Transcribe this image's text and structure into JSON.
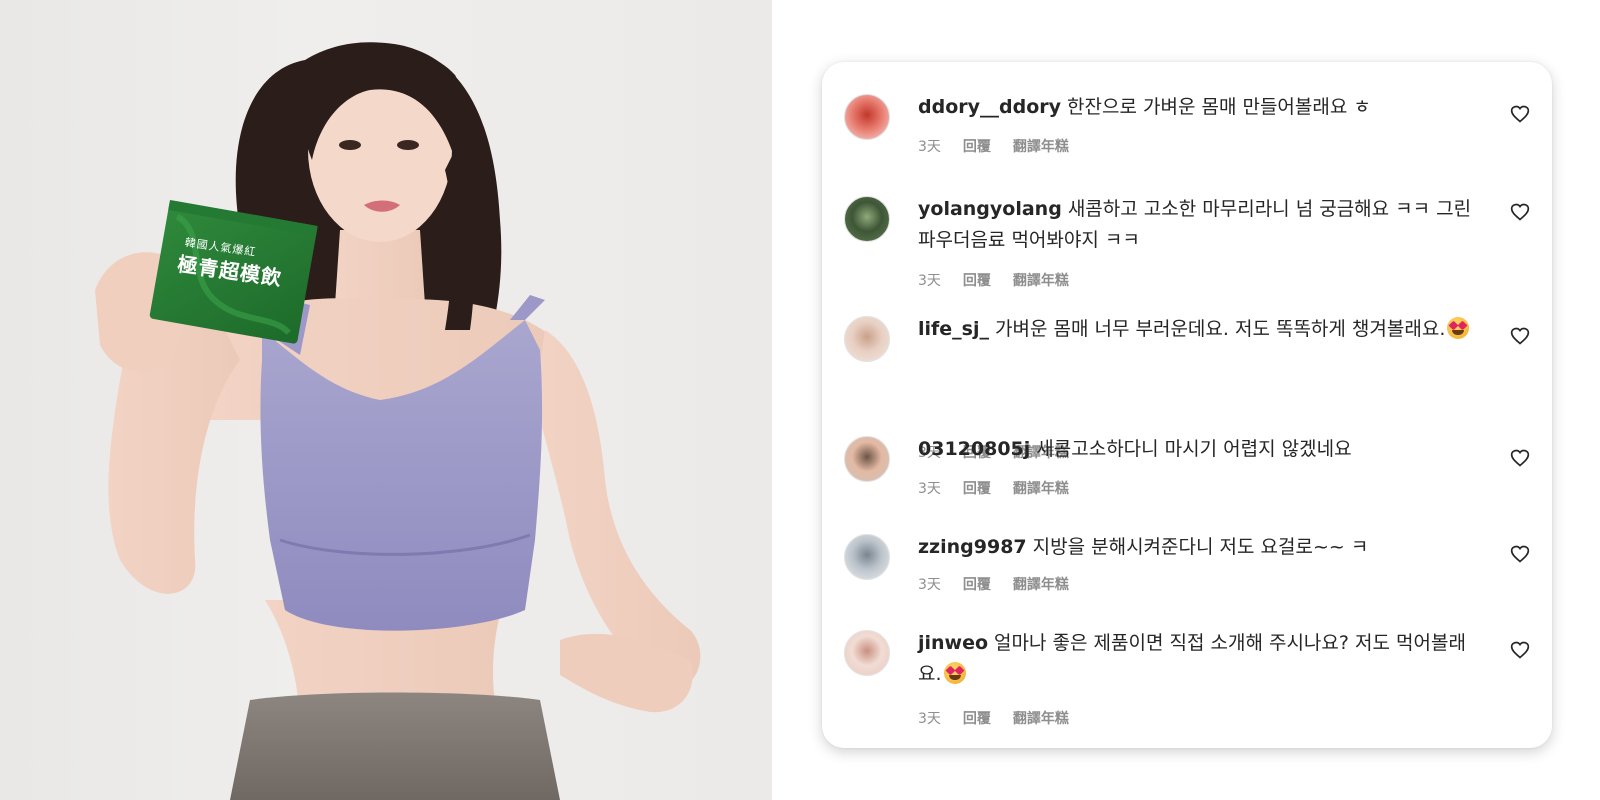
{
  "photo": {
    "package_brand": "韓國人氣爆紅",
    "package_name": "極青超模飲"
  },
  "comments": [
    {
      "username": "ddory__ddory",
      "text": "한잔으로 가벼운 몸매 만들어볼래요 ㅎ",
      "emoji": false,
      "time": "3天",
      "reply": "回覆",
      "translate": "翻譯年糕",
      "avatar_colors": [
        "#f5d9d4",
        "#c0392b",
        "#e87a6e"
      ]
    },
    {
      "username": "yolangyolang",
      "text": "새콤하고 고소한 마무리라니 넘 궁금해요 ㅋㅋ 그린파우더음료 먹어봐야지 ㅋㅋ",
      "emoji": false,
      "time": "3天",
      "reply": "回覆",
      "translate": "翻譯年糕",
      "avatar_colors": [
        "#5f7d55",
        "#8faa7a",
        "#3e5636"
      ]
    },
    {
      "username": "life_sj_",
      "text": "가벼운 몸매 너무 부러운데요. 저도 똑똑하게 챙겨볼래요.",
      "emoji": true,
      "time": "3天",
      "reply": "回覆",
      "translate": "翻譯年糕",
      "avatar_colors": [
        "#f1e6e0",
        "#c9a08a",
        "#e8cfc2"
      ]
    },
    {
      "username": "03120805j",
      "text": "새콤고소하다니 마시기 어렵지 않겠네요",
      "emoji": false,
      "time": "3天",
      "reply": "回覆",
      "translate": "翻譯年糕",
      "avatar_colors": [
        "#cfc2b8",
        "#6d5446",
        "#e3b9a4"
      ]
    },
    {
      "username": "zzing9987",
      "text": "지방을 분해시켜준다니 저도 요걸로~~ ㅋ",
      "emoji": false,
      "time": "3天",
      "reply": "回覆",
      "translate": "翻譯年糕",
      "avatar_colors": [
        "#e8ecef",
        "#7a8591",
        "#bcc4cb"
      ]
    },
    {
      "username": "jinweo",
      "text": "얼마나 좋은 제품이면 직접 소개해 주시나요? 저도 먹어볼래요.",
      "emoji": true,
      "time": "3天",
      "reply": "回覆",
      "translate": "翻譯年糕",
      "avatar_colors": [
        "#e9c9bf",
        "#c98f80",
        "#f1dcd4"
      ]
    }
  ]
}
